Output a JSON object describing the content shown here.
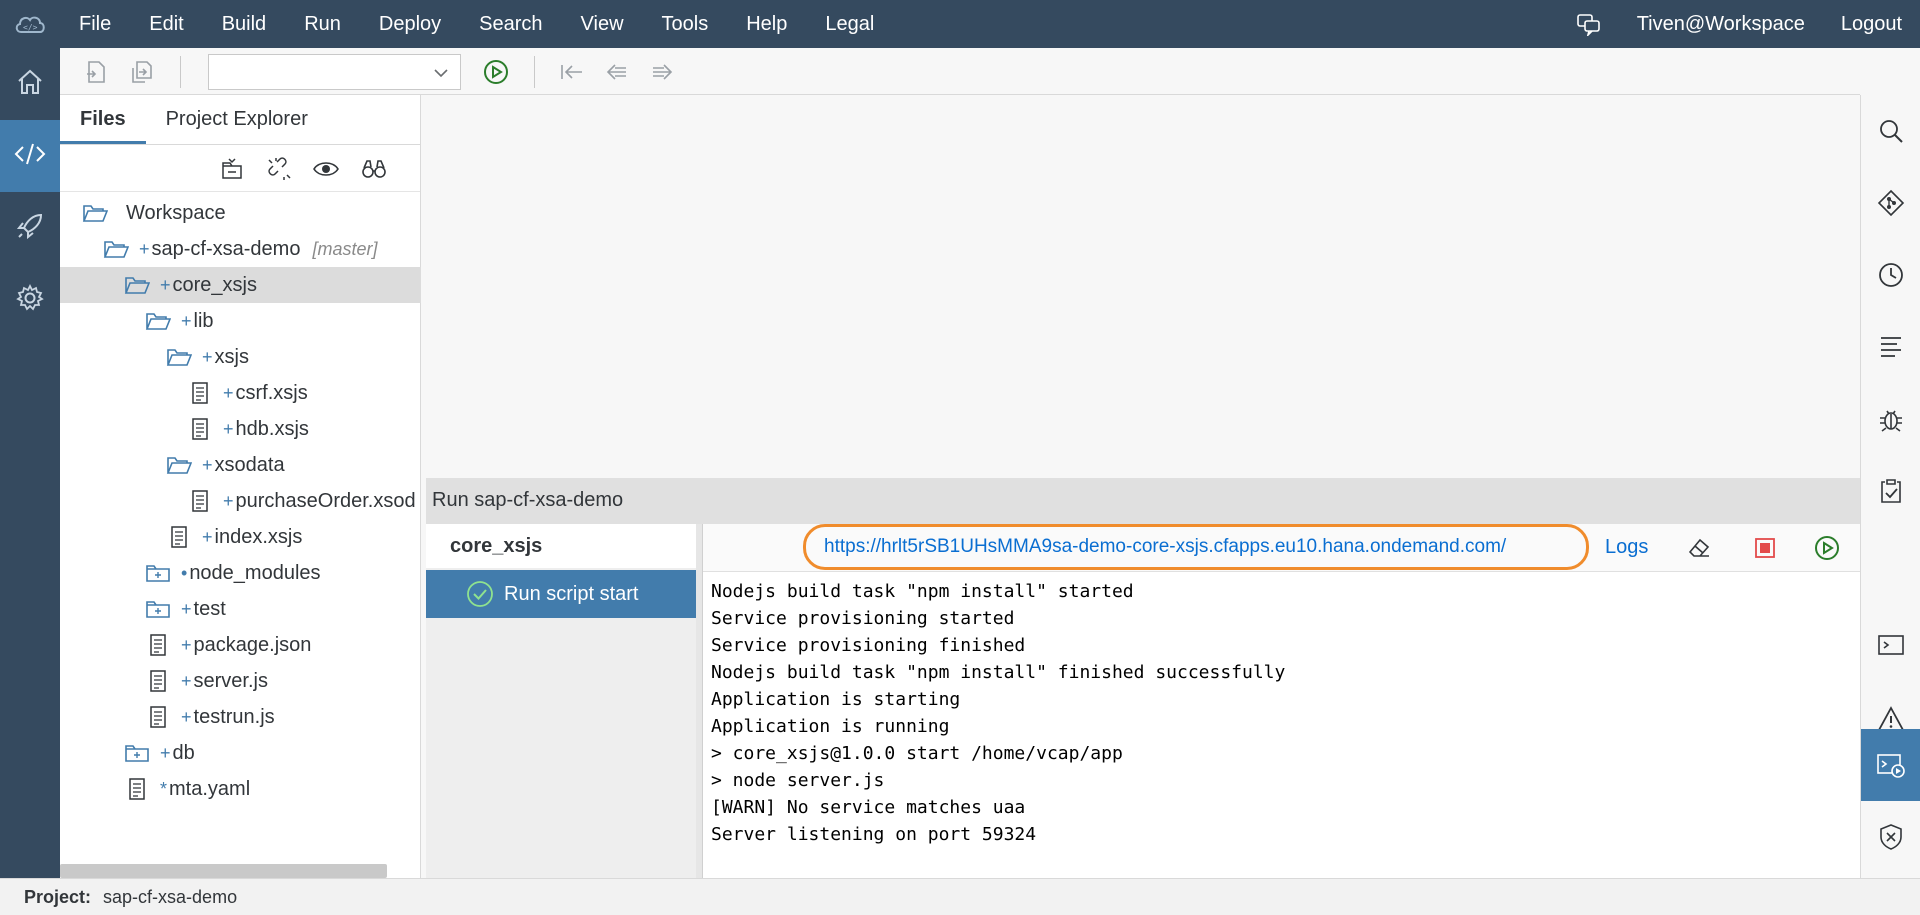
{
  "menu": {
    "items": [
      "File",
      "Edit",
      "Build",
      "Run",
      "Deploy",
      "Search",
      "View",
      "Tools",
      "Help",
      "Legal"
    ],
    "user": "Tiven@Workspace",
    "logout": "Logout"
  },
  "left_panel": {
    "tabs": [
      {
        "label": "Files",
        "active": true
      },
      {
        "label": "Project Explorer",
        "active": false
      }
    ],
    "tree": [
      {
        "label": "Workspace",
        "type": "folder-open",
        "mark": "",
        "level": 0
      },
      {
        "label": "sap-cf-xsa-demo",
        "type": "folder-open",
        "mark": "+",
        "branch": "[master]",
        "level": 1
      },
      {
        "label": "core_xsjs",
        "type": "folder-open",
        "mark": "+",
        "level": 2,
        "selected": true
      },
      {
        "label": "lib",
        "type": "folder-open",
        "mark": "+",
        "level": 3
      },
      {
        "label": "xsjs",
        "type": "folder-open",
        "mark": "+",
        "level": 4
      },
      {
        "label": "csrf.xsjs",
        "type": "file",
        "mark": "+",
        "level": 5
      },
      {
        "label": "hdb.xsjs",
        "type": "file",
        "mark": "+",
        "level": 5
      },
      {
        "label": "xsodata",
        "type": "folder-open",
        "mark": "+",
        "level": 4
      },
      {
        "label": "purchaseOrder.xsod",
        "type": "file",
        "mark": "+",
        "level": 5
      },
      {
        "label": "index.xsjs",
        "type": "file",
        "mark": "+",
        "level": 4
      },
      {
        "label": "node_modules",
        "type": "folder-closed",
        "mark": "•",
        "level": 3
      },
      {
        "label": "test",
        "type": "folder-closed",
        "mark": "+",
        "level": 3
      },
      {
        "label": "package.json",
        "type": "file",
        "mark": "+",
        "level": 3
      },
      {
        "label": "server.js",
        "type": "file",
        "mark": "+",
        "level": 3
      },
      {
        "label": "testrun.js",
        "type": "file",
        "mark": "+",
        "level": 3
      },
      {
        "label": "db",
        "type": "folder-closed",
        "mark": "+",
        "level": 2
      },
      {
        "label": "mta.yaml",
        "type": "file",
        "mark": "*",
        "level": 2
      }
    ]
  },
  "run": {
    "title": "Run sap-cf-xsa-demo",
    "module": "core_xsjs",
    "script": "Run script start",
    "url": "https://hrlt5rSB1UHsMMA9sa-demo-core-xsjs.cfapps.eu10.hana.ondemand.com/",
    "logs": "Logs",
    "console": [
      "Nodejs build task \"npm install\" started",
      "Service provisioning started",
      "Service provisioning finished",
      "Nodejs build task \"npm install\" finished successfully",
      "Application is starting",
      "Application is running",
      "> core_xsjs@1.0.0 start /home/vcap/app",
      "> node server.js",
      "[WARN] No service matches uaa",
      "Server listening on port 59324"
    ]
  },
  "status": {
    "label": "Project:",
    "value": "sap-cf-xsa-demo"
  },
  "colors": {
    "shell": "#354a5f",
    "accent": "#427cac",
    "link": "#0a6ed1",
    "highlight": "#f08c2c",
    "success": "#2b7d2b",
    "stop": "#e34b4b"
  }
}
